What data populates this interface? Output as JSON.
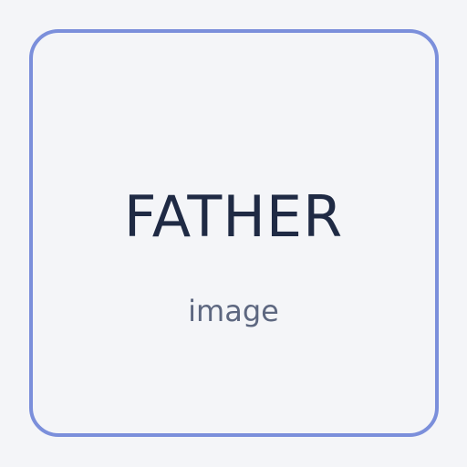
{
  "card": {
    "word": "FATHER",
    "caption": "image"
  },
  "colors": {
    "background": "#f4f5f8",
    "border": "#7b8fdb",
    "word": "#1f2a44",
    "caption": "#5d6780"
  }
}
